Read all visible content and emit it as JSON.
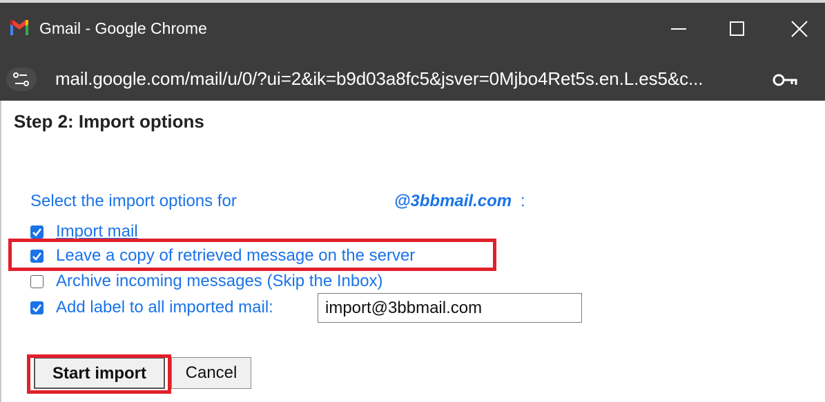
{
  "window": {
    "title": "Gmail - Google Chrome",
    "url": "mail.google.com/mail/u/0/?ui=2&ik=b9d03a8fc5&jsver=0Mjbo4Ret5s.en.L.es5&c...",
    "icons": [
      "gmail-logo-icon",
      "minimize-icon",
      "maximize-icon",
      "close-icon",
      "site-info-icon",
      "key-icon"
    ]
  },
  "dialog": {
    "heading": "Step 2: Import options",
    "select_label": "Select the import options for",
    "email": "@3bbmail.com",
    "colon": ":",
    "options": [
      {
        "label": "Import mail",
        "checked": true
      },
      {
        "label": "Leave a copy of retrieved message on the server",
        "checked": true
      },
      {
        "label": "Archive incoming messages (Skip the Inbox)",
        "checked": false
      },
      {
        "label": "Add label to all imported mail:",
        "checked": true
      }
    ],
    "label_value": "import@3bbmail.com",
    "start_button": "Start import",
    "cancel_button": "Cancel"
  },
  "colors": {
    "chrome_dark": "#3c3c3c",
    "link_blue": "#1a73e8",
    "highlight_red": "#e0202a"
  }
}
